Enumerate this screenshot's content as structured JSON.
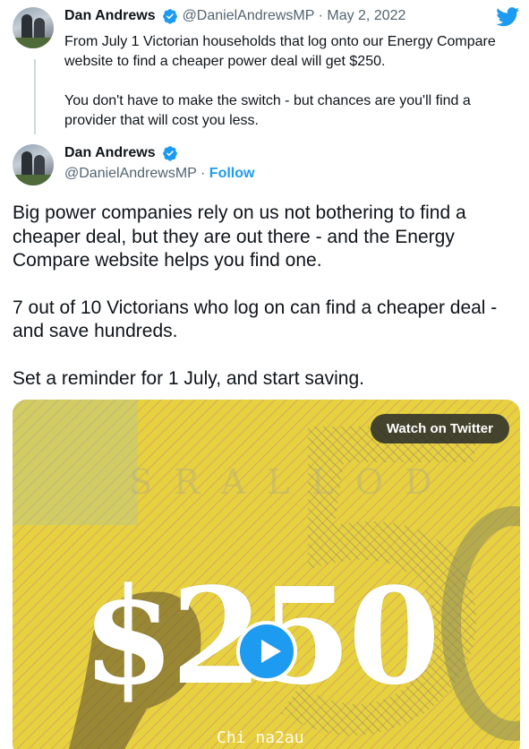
{
  "quoted_tweet": {
    "author_name": "Dan Andrews",
    "handle": "@DanielAndrewsMP",
    "separator": "·",
    "date": "May 2, 2022",
    "paragraphs": [
      "From July 1 Victorian households that log onto our Energy Compare website to find a cheaper power deal will get $250.",
      "You don't have to make the switch - but chances are you'll find a provider that will cost you less."
    ]
  },
  "tweet": {
    "author_name": "Dan Andrews",
    "handle": "@DanielAndrewsMP",
    "separator": "·",
    "follow_label": "Follow",
    "paragraphs": [
      "Big power companies rely on us not bothering to find a cheaper deal, but they are out there - and the Energy Compare website helps you find one.",
      "7 out of 10 Victorians who log on can find a cheaper deal - and save hundreds.",
      "Set a reminder for 1 July, and start saving."
    ]
  },
  "media": {
    "watch_label": "Watch on Twitter",
    "overlay_amount": "$250",
    "watermark": "Chi na2au"
  },
  "colors": {
    "accent": "#1d9bf0",
    "text": "#0f1419",
    "muted": "#536471",
    "note_yellow": "#e5cf3c"
  },
  "icons": [
    "twitter-bird-icon",
    "verified-badge-icon",
    "play-icon"
  ]
}
